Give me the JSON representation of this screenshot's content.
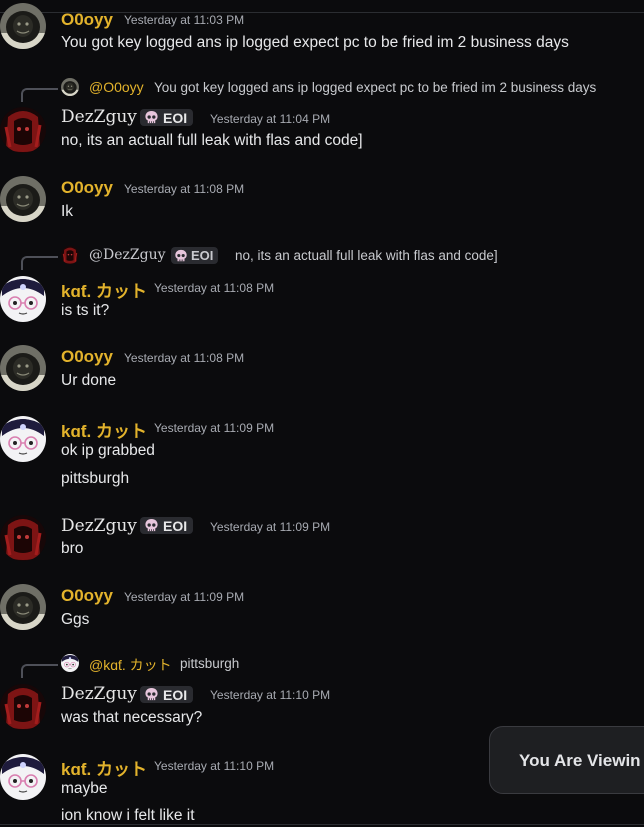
{
  "users": {
    "o0oyy": "O0oyy",
    "dezzguy": "DezZguy",
    "kat": "kɑƭ. カット"
  },
  "tags": {
    "eoi": "EOI"
  },
  "messages": [
    {
      "author": "O0oyy",
      "timestamp": "Yesterday at 11:03 PM",
      "lines": [
        "You got key logged ans ip logged expect pc to be fried im 2 business days"
      ]
    },
    {
      "reply_to": {
        "name": "@O0oyy",
        "text": "You got key logged ans ip logged expect pc to be fried im 2 business days"
      },
      "author": "DezZguy",
      "tag": "EOI",
      "timestamp": "Yesterday at 11:04 PM",
      "lines": [
        "no, its an actuall full leak with flas and code]"
      ]
    },
    {
      "author": "O0oyy",
      "timestamp": "Yesterday at 11:08 PM",
      "lines": [
        "Ik"
      ]
    },
    {
      "reply_to": {
        "name": "@DezZguy",
        "tag": "EOI",
        "text": "no, its an actuall full leak with flas and code]"
      },
      "author": "kɑƭ. カット",
      "timestamp": "Yesterday at 11:08 PM",
      "lines": [
        "is ts it?"
      ]
    },
    {
      "author": "O0oyy",
      "timestamp": "Yesterday at 11:08 PM",
      "lines": [
        "Ur done"
      ]
    },
    {
      "author": "kɑƭ. カット",
      "timestamp": "Yesterday at 11:09 PM",
      "lines": [
        "ok ip grabbed",
        "pittsburgh"
      ]
    },
    {
      "author": "DezZguy",
      "tag": "EOI",
      "timestamp": "Yesterday at 11:09 PM",
      "lines": [
        "bro"
      ]
    },
    {
      "author": "O0oyy",
      "timestamp": "Yesterday at 11:09 PM",
      "lines": [
        "Ggs"
      ]
    },
    {
      "reply_to": {
        "name": "@kɑƭ. カット",
        "text": "pittsburgh"
      },
      "author": "DezZguy",
      "tag": "EOI",
      "timestamp": "Yesterday at 11:10 PM",
      "lines": [
        "was that necessary?"
      ]
    },
    {
      "author": "kɑƭ. カット",
      "timestamp": "Yesterday at 11:10 PM",
      "lines": [
        "maybe",
        "ion know i felt like it"
      ]
    }
  ],
  "toast": {
    "text": "You Are Viewin"
  },
  "colors": {
    "background": "#0b0b0d",
    "username_gold": "#e3b32c",
    "tag_bg": "#2a2b30"
  },
  "icons": {
    "eoi_tag_icon": "skull-icon"
  }
}
